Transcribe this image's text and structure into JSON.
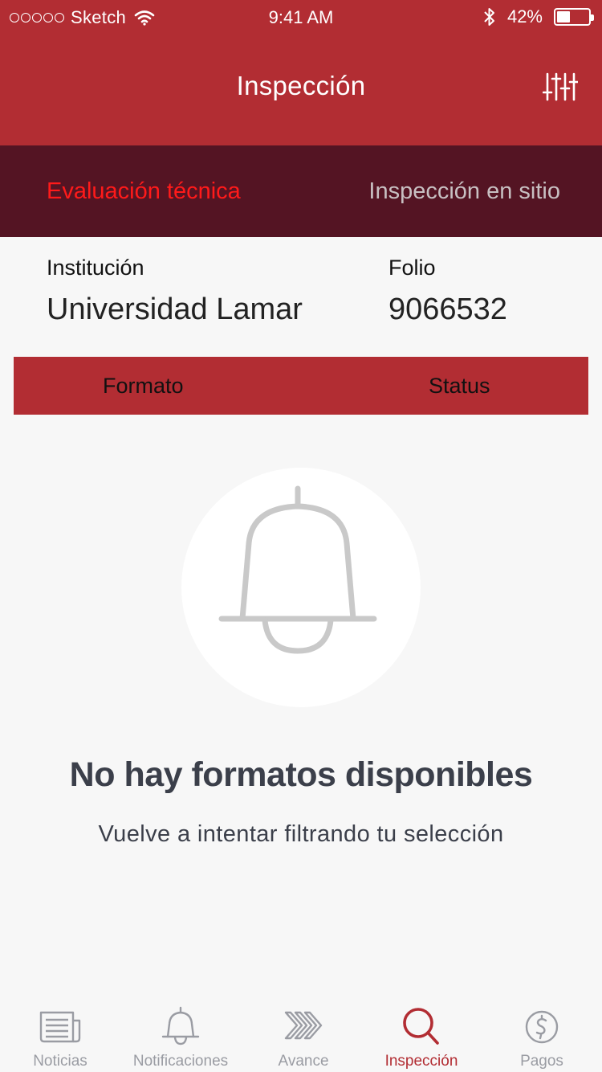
{
  "status_bar": {
    "carrier": "Sketch",
    "time": "9:41 AM",
    "battery": "42%",
    "battery_level": 0.42
  },
  "header": {
    "title": "Inspección",
    "filter_icon": "sliders-icon"
  },
  "tabs": [
    {
      "label": "Evaluación técnica",
      "active": true
    },
    {
      "label": "Inspección en sitio",
      "active": false
    }
  ],
  "info": {
    "institucion_label": "Institución",
    "institucion_value": "Universidad Lamar",
    "folio_label": "Folio",
    "folio_value": "9066532"
  },
  "table": {
    "columns": [
      "Formato",
      "Status"
    ]
  },
  "empty_state": {
    "icon": "bell-icon",
    "title": "No hay formatos disponibles",
    "subtitle": "Vuelve a intentar filtrando tu selección"
  },
  "tabbar": {
    "items": [
      {
        "label": "Noticias",
        "icon": "newspaper-icon",
        "active": false
      },
      {
        "label": "Notificaciones",
        "icon": "bell-icon",
        "active": false
      },
      {
        "label": "Avance",
        "icon": "chevrons-right-icon",
        "active": false
      },
      {
        "label": "Inspección",
        "icon": "search-icon",
        "active": true
      },
      {
        "label": "Pagos",
        "icon": "dollar-coin-icon",
        "active": false
      }
    ]
  },
  "colors": {
    "primary": "#b22d33",
    "tab_bar_dark": "#541423",
    "active_tab_text": "#ff1a1a",
    "inactive_tab_text": "#c8c0c2",
    "background": "#f7f7f7",
    "muted_text": "#9a9ca3",
    "empty_title": "#3b3f4a"
  }
}
